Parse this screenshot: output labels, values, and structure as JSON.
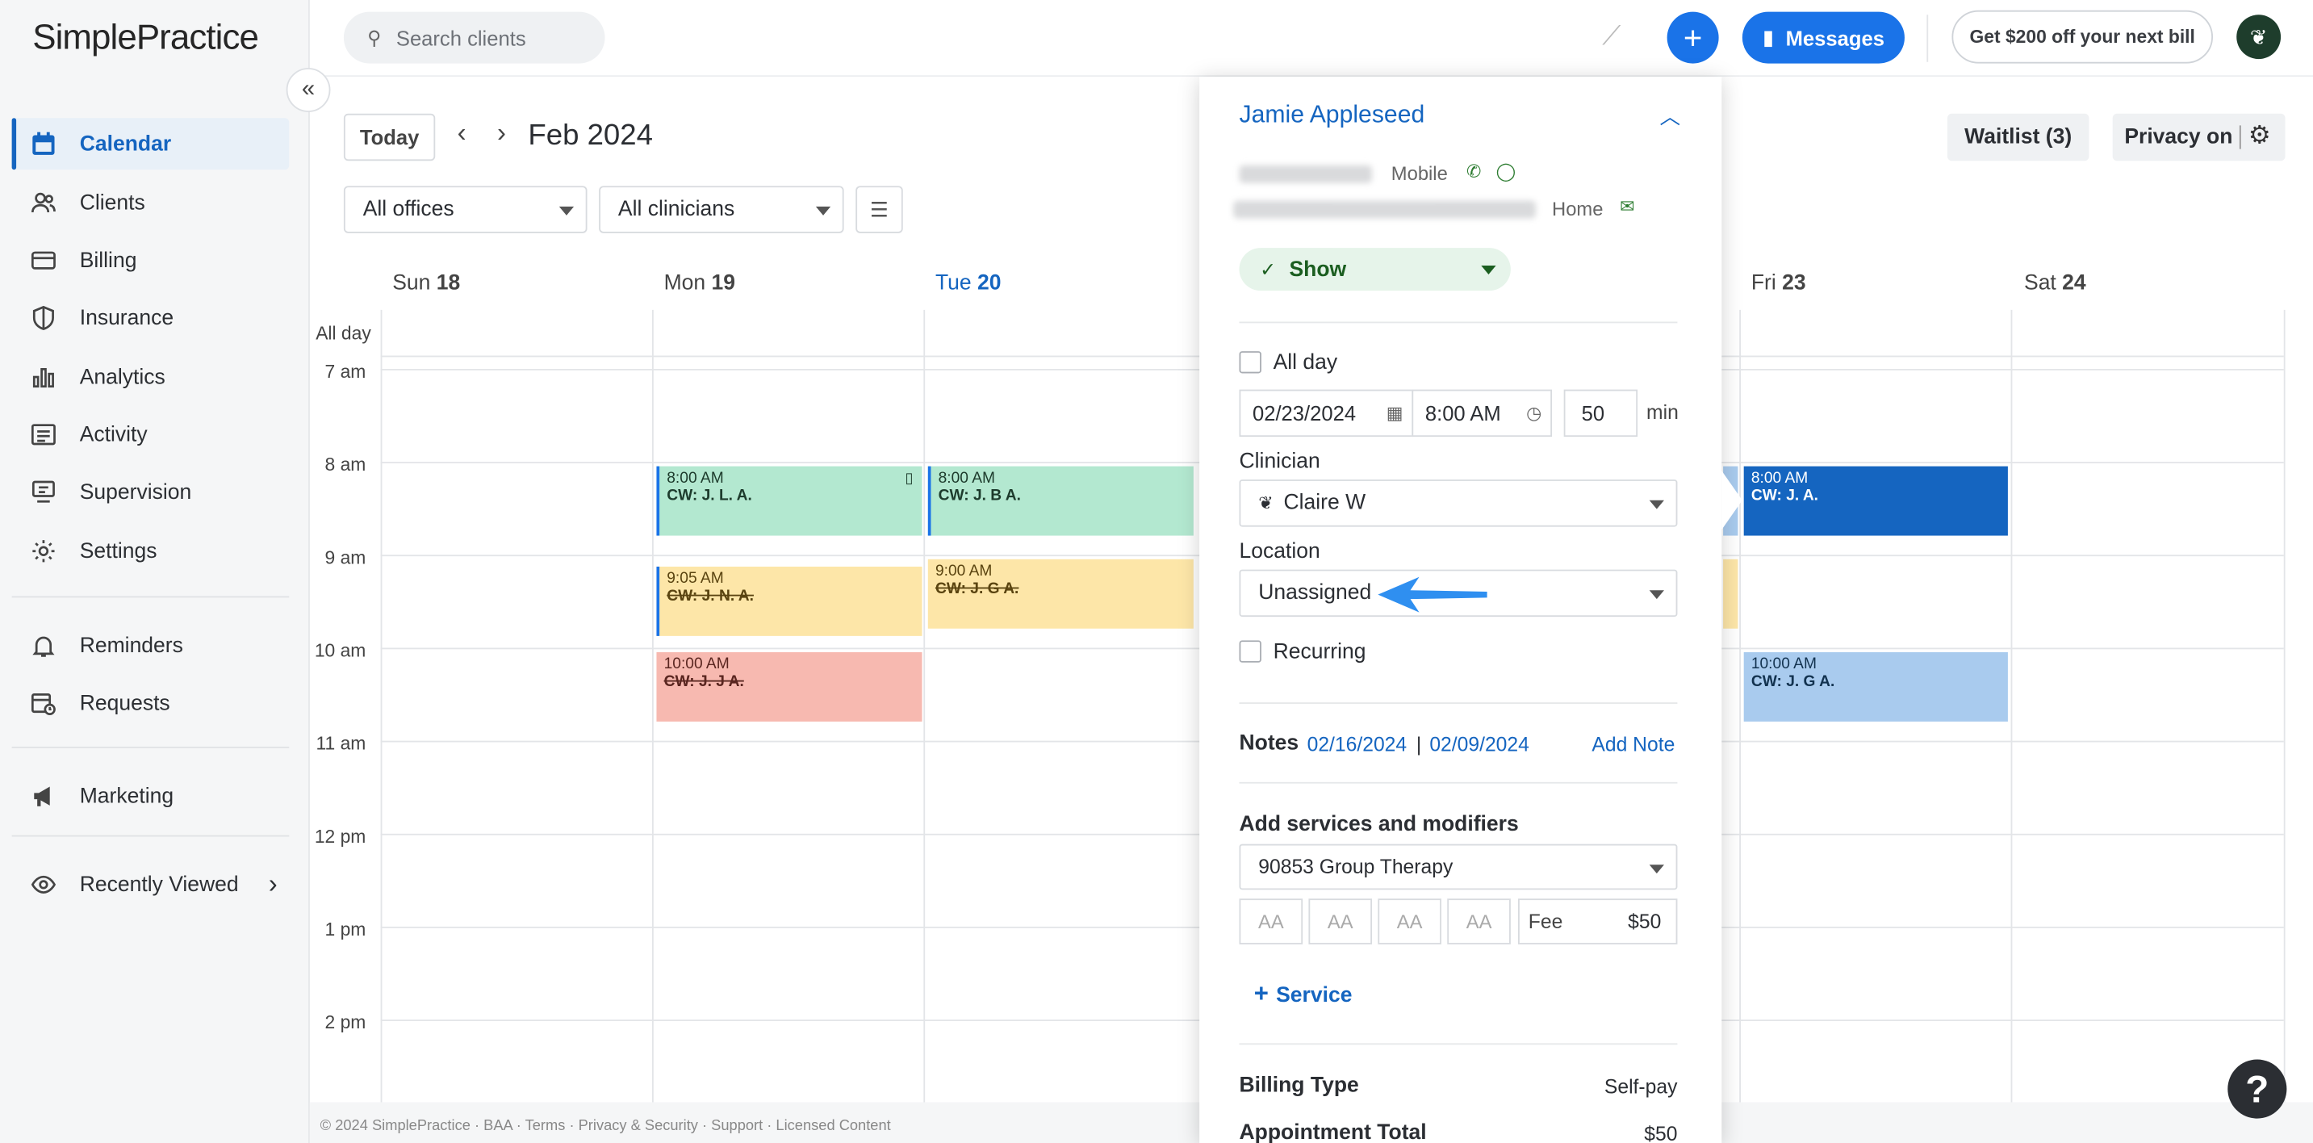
{
  "app": {
    "logo": "SimplePractice"
  },
  "sidebar": {
    "items": [
      {
        "label": "Calendar",
        "icon": "calendar-icon",
        "active": true
      },
      {
        "label": "Clients",
        "icon": "people-icon"
      },
      {
        "label": "Billing",
        "icon": "credit-card-icon"
      },
      {
        "label": "Insurance",
        "icon": "shield-icon"
      },
      {
        "label": "Analytics",
        "icon": "bar-chart-icon"
      },
      {
        "label": "Activity",
        "icon": "list-icon"
      },
      {
        "label": "Supervision",
        "icon": "supervision-icon"
      },
      {
        "label": "Settings",
        "icon": "gear-icon"
      }
    ],
    "secondary": [
      {
        "label": "Reminders",
        "icon": "bell-icon"
      },
      {
        "label": "Requests",
        "icon": "calendar-request-icon"
      }
    ],
    "marketing": {
      "label": "Marketing",
      "icon": "megaphone-icon"
    },
    "recently_viewed": {
      "label": "Recently Viewed",
      "icon": "eye-icon"
    }
  },
  "topbar": {
    "search_placeholder": "Search clients",
    "messages_label": "Messages",
    "promo_label": "Get $200 off your next bill"
  },
  "calendar": {
    "today_label": "Today",
    "month_label": "Feb 2024",
    "offices_label": "All offices",
    "clinicians_label": "All clinicians",
    "waitlist_label": "Waitlist (3)",
    "privacy_label": "Privacy on",
    "allday_label": "All day",
    "days": [
      {
        "name": "Sun",
        "num": "18"
      },
      {
        "name": "Mon",
        "num": "19"
      },
      {
        "name": "Tue",
        "num": "20"
      },
      {
        "name": "Fri",
        "num": "23"
      },
      {
        "name": "Sat",
        "num": "24"
      }
    ],
    "times": [
      "7 am",
      "8 am",
      "9 am",
      "10 am",
      "11 am",
      "12 pm",
      "1 pm",
      "2 pm"
    ],
    "appointments": [
      {
        "time": "8:00 AM",
        "client": "CW: J. L. A."
      },
      {
        "time": "9:05 AM",
        "client": "CW: J. N. A."
      },
      {
        "time": "10:00 AM",
        "client": "CW: J. J A."
      },
      {
        "time": "8:00 AM",
        "client": "CW: J. B A."
      },
      {
        "time": "9:00 AM",
        "client": "CW: J. G A."
      },
      {
        "time": "8:00 AM",
        "client": "CW: J. A."
      },
      {
        "time": "10:00 AM",
        "client": "CW: J. G A."
      }
    ],
    "colors": {
      "green": "#b3e8d0",
      "yellow": "#fde6a8",
      "red": "#f7b9b0",
      "blue_dark": "#1565c0",
      "blue_light": "#a9cbee"
    }
  },
  "panel": {
    "client_name": "Jamie Appleseed",
    "phone_type": "Mobile",
    "email_type": "Home",
    "status": "Show",
    "all_day_label": "All day",
    "date": "02/23/2024",
    "time": "8:00 AM",
    "duration": "50",
    "duration_unit": "min",
    "clinician_label": "Clinician",
    "clinician_value": "Claire W",
    "location_label": "Location",
    "location_value": "Unassigned",
    "recurring_label": "Recurring",
    "notes_label": "Notes",
    "note_date_1": "02/16/2024",
    "note_sep": "|",
    "note_date_2": "02/09/2024",
    "add_note_label": "Add Note",
    "services_label": "Add services and modifiers",
    "service_value": "90853 Group Therapy",
    "modifier_placeholder": "AA",
    "fee_label": "Fee",
    "fee_value": "$50",
    "add_service_label": "Service",
    "billing_type_label": "Billing Type",
    "billing_type_value": "Self-pay",
    "appointment_total_label": "Appointment Total",
    "appointment_total_value": "$50"
  },
  "footer": {
    "text": "© 2024 SimplePractice · BAA · Terms · Privacy & Security · Support · Licensed Content"
  },
  "help": {
    "label": "?"
  }
}
